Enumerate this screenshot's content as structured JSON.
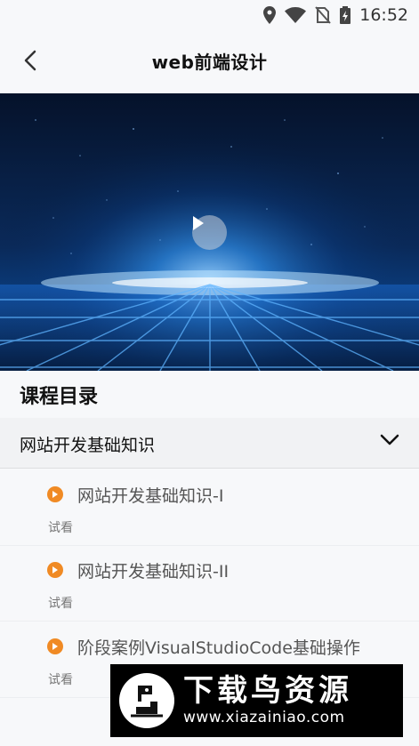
{
  "status": {
    "time": "16:52"
  },
  "header": {
    "title": "web前端设计"
  },
  "catalog": {
    "title": "课程目录",
    "chapter": {
      "label": "网站开发基础知识"
    },
    "lessons": [
      {
        "title": "网站开发基础知识-I",
        "tag": "试看"
      },
      {
        "title": "网站开发基础知识-II",
        "tag": "试看"
      },
      {
        "title": "阶段案例VisualStudioCode基础操作",
        "tag": "试看"
      }
    ]
  },
  "watermark": {
    "name": "下载鸟资源",
    "url": "www.xiazainiao.com"
  },
  "colors": {
    "accent": "#f08a24",
    "background": "#f7f8fa"
  }
}
